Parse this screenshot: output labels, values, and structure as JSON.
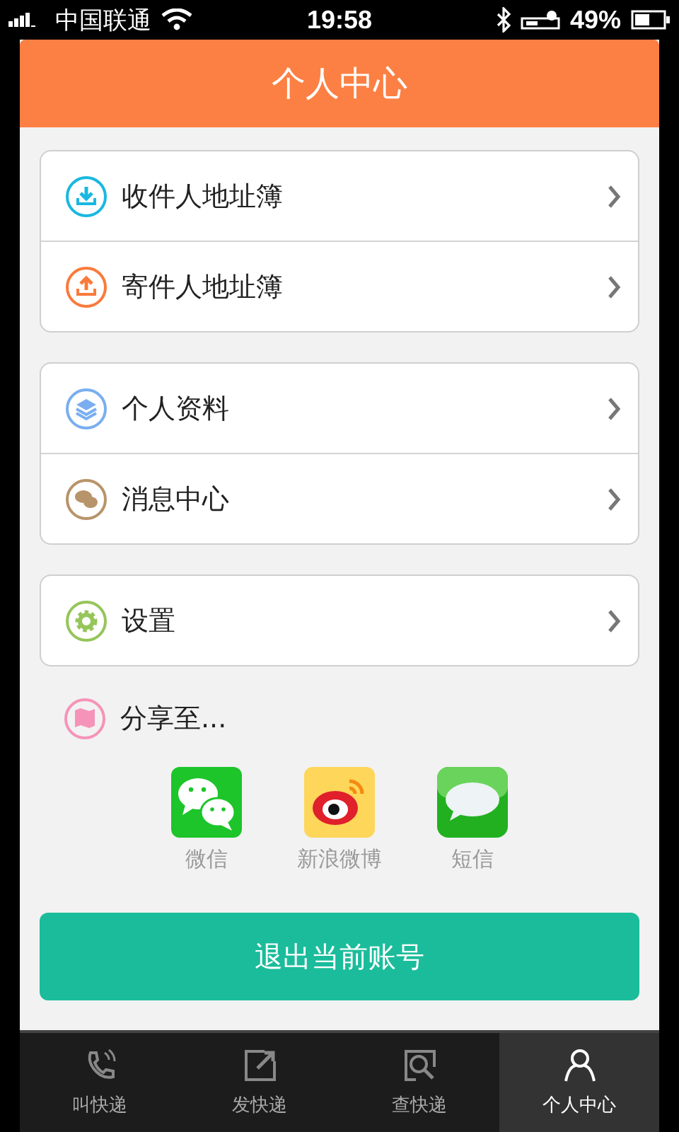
{
  "status_bar": {
    "carrier": "中国联通",
    "time": "19:58",
    "battery": "49%"
  },
  "header": {
    "title": "个人中心"
  },
  "groups": [
    [
      {
        "label": "收件人地址簿",
        "kind": "download",
        "color": "#19b8e0"
      },
      {
        "label": "寄件人地址簿",
        "kind": "upload",
        "color": "#fa7a3c"
      }
    ],
    [
      {
        "label": "个人资料",
        "kind": "layers",
        "color": "#7aaef0"
      },
      {
        "label": "消息中心",
        "kind": "chat",
        "color": "#b8946a"
      }
    ],
    [
      {
        "label": "设置",
        "kind": "gear",
        "color": "#96c55a"
      }
    ]
  ],
  "share": {
    "label": "分享至...",
    "color": "#f594b8",
    "targets": [
      {
        "label": "微信",
        "kind": "wechat"
      },
      {
        "label": "新浪微博",
        "kind": "weibo"
      },
      {
        "label": "短信",
        "kind": "sms"
      }
    ]
  },
  "logout_button": "退出当前账号",
  "tabs": [
    {
      "label": "叫快递",
      "kind": "phone",
      "selected": false
    },
    {
      "label": "发快递",
      "kind": "compose",
      "selected": false
    },
    {
      "label": "查快递",
      "kind": "search",
      "selected": false
    },
    {
      "label": "个人中心",
      "kind": "person",
      "selected": true
    }
  ]
}
